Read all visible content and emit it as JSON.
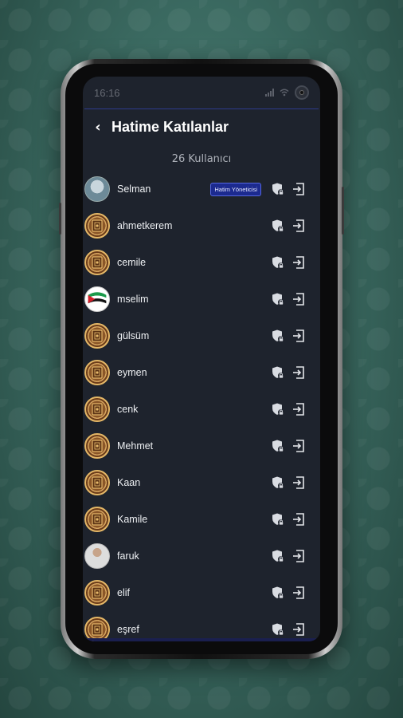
{
  "status": {
    "time": "16:16"
  },
  "header": {
    "back_icon": "chevron-left-icon",
    "title": "Hatime Katılanlar"
  },
  "subtitle": "26 Kullanıcı",
  "badge_label": "Hatim Yöneticisi",
  "users": [
    {
      "name": "Selman",
      "avatar": "photo",
      "badge": true
    },
    {
      "name": "ahmetkerem",
      "avatar": "quran"
    },
    {
      "name": "cemile",
      "avatar": "quran"
    },
    {
      "name": "mselim",
      "avatar": "flag"
    },
    {
      "name": "gülsüm",
      "avatar": "quran"
    },
    {
      "name": "eymen",
      "avatar": "quran"
    },
    {
      "name": "cenk",
      "avatar": "quran"
    },
    {
      "name": "Mehmet",
      "avatar": "quran"
    },
    {
      "name": "Kaan",
      "avatar": "quran"
    },
    {
      "name": "Kamile",
      "avatar": "quran"
    },
    {
      "name": "faruk",
      "avatar": "portrait"
    },
    {
      "name": "elif",
      "avatar": "quran"
    },
    {
      "name": "eşref",
      "avatar": "quran"
    }
  ],
  "row_icons": {
    "security": "shield-lock-icon",
    "exit": "exit-icon"
  }
}
